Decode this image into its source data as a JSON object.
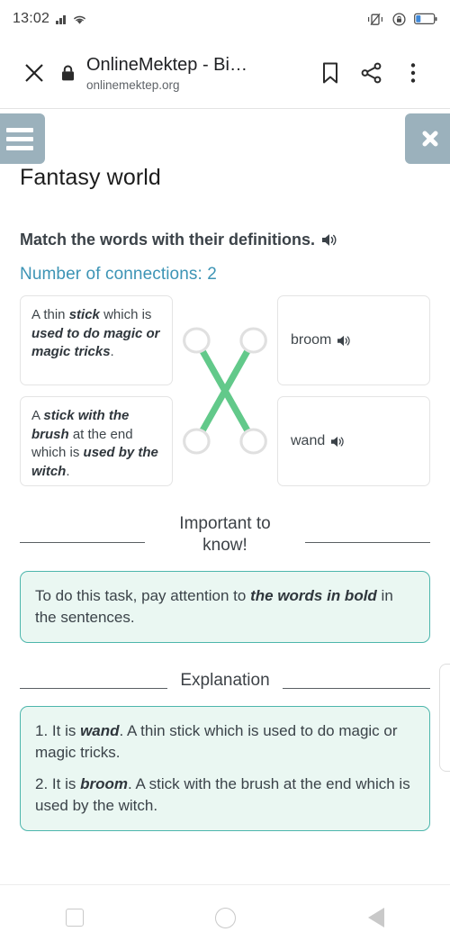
{
  "status_bar": {
    "time": "13:02",
    "icons": [
      "signal-bars-icon",
      "wifi-icon",
      "vibrate-mode-icon",
      "rotation-lock-icon",
      "battery-icon"
    ]
  },
  "browser": {
    "close_icon": "close-icon",
    "lock_icon": "lock-icon",
    "title": "OnlineMektep - Bi…",
    "url": "onlinemektep.org",
    "bookmark_icon": "bookmark-icon",
    "share_icon": "share-icon",
    "menu_icon": "overflow-menu-icon"
  },
  "lesson": {
    "menu_button_label": "menu",
    "close_button_label": "close",
    "title": "Fantasy world",
    "instruction": "Match the words with their definitions.",
    "instruction_audio_icon": "speaker-icon",
    "connections_label": "Number of connections: 2"
  },
  "match_task": {
    "left_items": [
      {
        "id": "def-1",
        "parts": [
          {
            "text": "A thin ",
            "bold": false
          },
          {
            "text": "stick",
            "bold": true
          },
          {
            "text": " which is ",
            "bold": false
          },
          {
            "text": "used to do magic or magic tricks",
            "bold": true
          },
          {
            "text": ".",
            "bold": false
          }
        ]
      },
      {
        "id": "def-2",
        "parts": [
          {
            "text": "A ",
            "bold": false
          },
          {
            "text": "stick with the brush",
            "bold": true
          },
          {
            "text": " at the end which is ",
            "bold": false
          },
          {
            "text": "used by the witch",
            "bold": true
          },
          {
            "text": ".",
            "bold": false
          }
        ]
      }
    ],
    "right_items": [
      {
        "id": "word-broom",
        "label": "broom",
        "audio_icon": "speaker-icon"
      },
      {
        "id": "word-wand",
        "label": "wand",
        "audio_icon": "speaker-icon"
      }
    ],
    "connections": [
      {
        "from": "def-1",
        "to": "word-wand"
      },
      {
        "from": "def-2",
        "to": "word-broom"
      }
    ],
    "connection_color": "#62c98a",
    "node_border_color": "#e0e0e0"
  },
  "important": {
    "heading": "Important to know!",
    "parts": [
      {
        "text": "To do this task, pay attention to ",
        "bold": false
      },
      {
        "text": "the words in bold",
        "bold": true
      },
      {
        "text": " in the sentences.",
        "bold": false
      }
    ]
  },
  "explanation": {
    "heading": "Explanation",
    "items": [
      {
        "parts": [
          {
            "text": "1. It is ",
            "bold": false
          },
          {
            "text": "wand",
            "bold": true
          },
          {
            "text": ". A thin stick which is used to do magic or magic tricks.",
            "bold": false
          }
        ]
      },
      {
        "parts": [
          {
            "text": "2. It is ",
            "bold": false
          },
          {
            "text": "broom",
            "bold": true
          },
          {
            "text": ". A stick with the brush at the end which is used by the witch.",
            "bold": false
          }
        ]
      }
    ]
  },
  "nav_bar": {
    "recents_icon": "square-recents-icon",
    "home_icon": "circle-home-icon",
    "back_icon": "triangle-back-icon"
  },
  "colors": {
    "accent_teal": "#3d94b5",
    "button_gray_blue": "#9bb1bc",
    "box_border": "#4db6ac",
    "box_background": "#eaf7f2",
    "link_green": "#62c98a"
  }
}
